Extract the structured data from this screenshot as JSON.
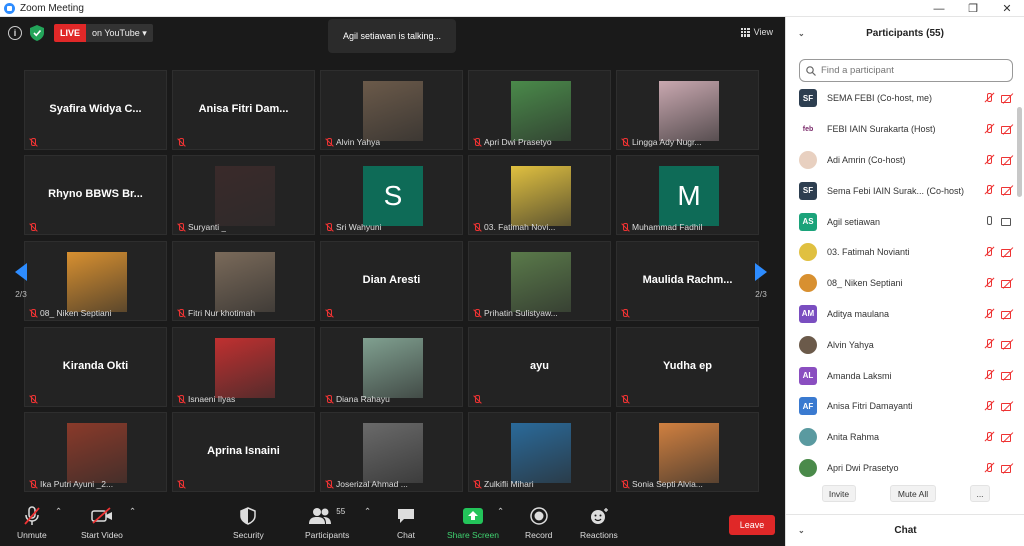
{
  "window": {
    "title": "Zoom Meeting"
  },
  "topbar": {
    "live": "LIVE",
    "destination": "on YouTube",
    "talking": "Agil setiawan is talking...",
    "view": "View"
  },
  "tiles": [
    {
      "name": "Syafira Widya C...",
      "label": "",
      "kind": "text"
    },
    {
      "name": "Anisa Fitri Dam...",
      "label": "",
      "kind": "text"
    },
    {
      "name": "",
      "label": "Alvin Yahya",
      "kind": "photo",
      "color": "#6b5a4a"
    },
    {
      "name": "",
      "label": "Apri Dwi Prasetyo",
      "kind": "photo",
      "color": "#4a8a4a"
    },
    {
      "name": "",
      "label": "Lingga Ady Nugr...",
      "kind": "photo",
      "color": "#c9a8b0"
    },
    {
      "name": "Rhyno BBWS Br...",
      "label": "",
      "kind": "text"
    },
    {
      "name": "",
      "label": "Suryanti _",
      "kind": "photo",
      "color": "#3a2a2a"
    },
    {
      "name": "",
      "label": "Sri Wahyuni",
      "kind": "letter",
      "letter": "S"
    },
    {
      "name": "",
      "label": "03. Fatimah Novi...",
      "kind": "photo",
      "color": "#e0c040"
    },
    {
      "name": "",
      "label": "Muhammad Fadhil",
      "kind": "letter",
      "letter": "M"
    },
    {
      "name": "",
      "label": "08_ Niken Septiani",
      "kind": "photo",
      "color": "#d89030"
    },
    {
      "name": "",
      "label": "Fitri Nur khotimah",
      "kind": "photo",
      "color": "#7a6a5a"
    },
    {
      "name": "Dian Aresti",
      "label": "",
      "kind": "text"
    },
    {
      "name": "",
      "label": "Prihatin Sulistyaw...",
      "kind": "photo",
      "color": "#5a7a4a"
    },
    {
      "name": "Maulida  Rachm...",
      "label": "",
      "kind": "text"
    },
    {
      "name": "Kiranda Okti",
      "label": "",
      "kind": "text"
    },
    {
      "name": "",
      "label": "Isnaeni Ilyas",
      "kind": "photo",
      "color": "#c03030"
    },
    {
      "name": "",
      "label": "Diana Rahayu",
      "kind": "photo",
      "color": "#80a090"
    },
    {
      "name": "ayu",
      "label": "",
      "kind": "text"
    },
    {
      "name": "Yudha ep",
      "label": "",
      "kind": "text"
    },
    {
      "name": "",
      "label": "Ika Putri Ayuni _2...",
      "kind": "photo",
      "color": "#8a3a2a"
    },
    {
      "name": "Aprina Isnaini",
      "label": "",
      "kind": "text"
    },
    {
      "name": "",
      "label": "Joserizal Ahmad ...",
      "kind": "photo",
      "color": "#6a6a6a"
    },
    {
      "name": "",
      "label": "Zulkifli Mihari",
      "kind": "photo",
      "color": "#2a6a9a"
    },
    {
      "name": "",
      "label": "Sonia Septi Alvia...",
      "kind": "photo",
      "color": "#d08040"
    }
  ],
  "pager": {
    "left": "2/3",
    "right": "2/3"
  },
  "toolbar": {
    "unmute": "Unmute",
    "start_video": "Start Video",
    "security": "Security",
    "participants": "Participants",
    "participants_count": "55",
    "chat": "Chat",
    "share_screen": "Share Screen",
    "record": "Record",
    "reactions": "Reactions",
    "leave": "Leave"
  },
  "panel": {
    "title": "Participants (55)",
    "search_placeholder": "Find a participant",
    "participants": [
      {
        "name": "SEMA FEBI (Co-host, me)",
        "initials": "SF",
        "color": "#2d3e50",
        "mic": "off",
        "video": "off"
      },
      {
        "name": "FEBI IAIN Surakarta (Host)",
        "initials": "feb",
        "color": "#ffffff",
        "mic": "off",
        "video": "off"
      },
      {
        "name": "Adi Amrin (Co-host)",
        "initials": "",
        "color": "#e8d0c0",
        "mic": "off",
        "video": "off"
      },
      {
        "name": "Sema Febi IAIN Surak...  (Co-host)",
        "initials": "SF",
        "color": "#2d3e50",
        "mic": "off",
        "video": "off"
      },
      {
        "name": "Agil setiawan",
        "initials": "AS",
        "color": "#1ba37a",
        "mic": "on",
        "video": "on"
      },
      {
        "name": "03. Fatimah Novianti",
        "initials": "",
        "color": "#e0c040",
        "mic": "off",
        "video": "off"
      },
      {
        "name": "08_ Niken Septiani",
        "initials": "",
        "color": "#d89030",
        "mic": "off",
        "video": "off"
      },
      {
        "name": "Aditya maulana",
        "initials": "AM",
        "color": "#7a4ec0",
        "mic": "off",
        "video": "off"
      },
      {
        "name": "Alvin Yahya",
        "initials": "",
        "color": "#6b5a4a",
        "mic": "off",
        "video": "off"
      },
      {
        "name": "Amanda Laksmi",
        "initials": "AL",
        "color": "#8a4ec0",
        "mic": "off",
        "video": "off"
      },
      {
        "name": "Anisa Fitri Damayanti",
        "initials": "AF",
        "color": "#3a7ad0",
        "mic": "off",
        "video": "off"
      },
      {
        "name": "Anita Rahma",
        "initials": "",
        "color": "#5a9aa0",
        "mic": "off",
        "video": "off"
      },
      {
        "name": "Apri Dwi Prasetyo",
        "initials": "",
        "color": "#4a8a4a",
        "mic": "off",
        "video": "off"
      }
    ],
    "invite": "Invite",
    "mute_all": "Mute All",
    "more": "...",
    "chat_title": "Chat"
  }
}
